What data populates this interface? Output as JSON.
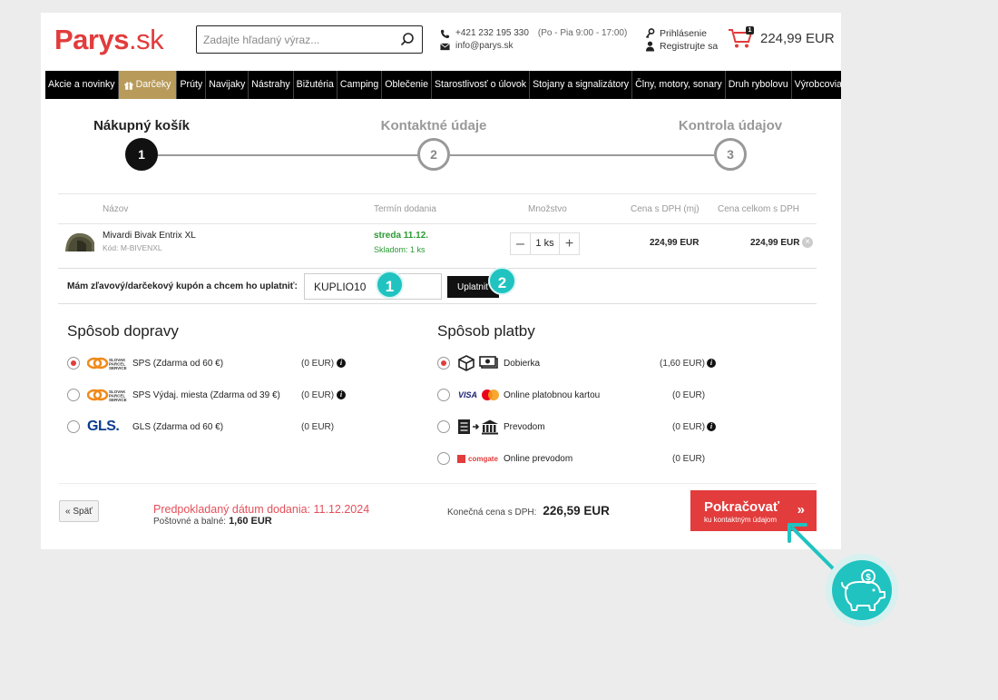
{
  "header": {
    "logo_main": "Parys",
    "logo_tld": ".sk",
    "search_placeholder": "Zadajte hľadaný výraz...",
    "phone": "+421 232 195 330",
    "hours": "(Po - Pia 9:00 - 17:00)",
    "email": "info@parys.sk",
    "login": "Prihlásenie",
    "register": "Registrujte sa",
    "cart_count": "1",
    "cart_total": "224,99 EUR"
  },
  "nav": {
    "items": [
      "Akcie a novinky",
      "Darčeky",
      "Prúty",
      "Navijaky",
      "Nástrahy",
      "Bižutéria",
      "Camping",
      "Oblečenie",
      "Starostlivosť o úlovok",
      "Stojany a signalizátory",
      "Člny, motory, sonary",
      "Druh rybolovu",
      "Výrobcovia"
    ]
  },
  "steps": [
    {
      "label": "Nákupný košík",
      "num": "1"
    },
    {
      "label": "Kontaktné údaje",
      "num": "2"
    },
    {
      "label": "Kontrola údajov",
      "num": "3"
    }
  ],
  "table": {
    "headers": {
      "name": "Názov",
      "delivery": "Termín dodania",
      "qty": "Množstvo",
      "unit": "Cena s DPH (mj)",
      "total": "Cena celkom s DPH"
    },
    "item": {
      "name": "Mivardi Bivak Entrix XL",
      "code": "Kód: M-BIVENXL",
      "delivery": "streda 11.12.",
      "stock": "Skladom: 1 ks",
      "qty_minus": "–",
      "qty": "1 ks",
      "qty_plus": "+",
      "unit_price": "224,99 EUR",
      "total_price": "224,99 EUR"
    }
  },
  "coupon": {
    "label": "Mám zľavový/darčekový kupón a chcem ho uplatniť:",
    "value": "KUPLIO10",
    "apply": "Uplatniť",
    "marker1": "1",
    "marker2": "2"
  },
  "shipping": {
    "title": "Spôsob dopravy",
    "options": [
      {
        "name": "SPS (Zdarma od 60 €)",
        "price": "(0 EUR)",
        "logo": "SLOVAK PARCEL SERVICE"
      },
      {
        "name": "SPS Výdaj. miesta (Zdarma od 39 €)",
        "price": "(0 EUR)",
        "logo": "SLOVAK PARCEL SERVICE"
      },
      {
        "name": "GLS (Zdarma od 60 €)",
        "price": "(0 EUR)",
        "logo": "GLS."
      }
    ]
  },
  "payment": {
    "title": "Spôsob platby",
    "options": [
      {
        "name": "Dobierka",
        "price": "(1,60 EUR)"
      },
      {
        "name": "Online platobnou kartou",
        "price": "(0 EUR)",
        "logo": "VISA"
      },
      {
        "name": "Prevodom",
        "price": "(0 EUR)"
      },
      {
        "name": "Online prevodom",
        "price": "(0 EUR)",
        "logo": "comgate"
      }
    ]
  },
  "footer": {
    "back": "« Späť",
    "est_delivery": "Predpokladaný dátum dodania: 11.12.2024",
    "shipping_label": "Poštovné a balné:",
    "shipping_value": "1,60 EUR",
    "final_label": "Konečná cena s DPH:",
    "final_value": "226,59 EUR",
    "cta_main": "Pokračovať",
    "cta_sub": "ku kontaktným údajom",
    "cta_chev": "»"
  },
  "colors": {
    "brand_red": "#e23c3c",
    "accent_teal": "#20c3c0",
    "gift_gold": "#b89a5a",
    "stock_green": "#2a9a33"
  }
}
